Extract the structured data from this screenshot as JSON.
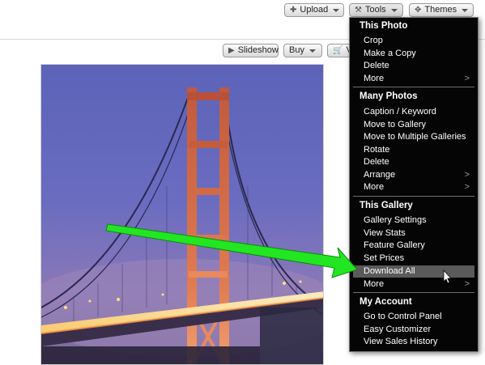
{
  "toolbar": {
    "upload_label": "Upload",
    "upload_icon": "plus-icon",
    "tools_label": "Tools",
    "tools_icon": "hammer-icon",
    "themes_label": "Themes",
    "themes_icon": "move-icon"
  },
  "photo_toolbar": {
    "slideshow_label": "Slideshow",
    "slideshow_icon": "play-icon",
    "buy_label": "Buy",
    "cart_label": "V",
    "cart_icon": "cart-icon"
  },
  "photo": {
    "subject": "golden-gate-bridge-at-dusk"
  },
  "menu": {
    "this_photo": {
      "heading": "This Photo",
      "items": [
        "Crop",
        "Make a Copy",
        "Delete",
        "More"
      ]
    },
    "many_photos": {
      "heading": "Many Photos",
      "items": [
        "Caption / Keyword",
        "Move to Gallery",
        "Move to Multiple Galleries",
        "Rotate",
        "Delete",
        "Arrange",
        "More"
      ]
    },
    "this_gallery": {
      "heading": "This Gallery",
      "items": [
        "Gallery Settings",
        "View Stats",
        "Feature Gallery",
        "Set Prices",
        "Download All",
        "More"
      ],
      "highlighted": "Download All"
    },
    "my_account": {
      "heading": "My Account",
      "items": [
        "Go to Control Panel",
        "Easy Customizer",
        "View Sales History"
      ]
    },
    "submenu_glyph": ">"
  },
  "annotation": {
    "arrow_color": "#22e622",
    "points_to": "Download All"
  }
}
